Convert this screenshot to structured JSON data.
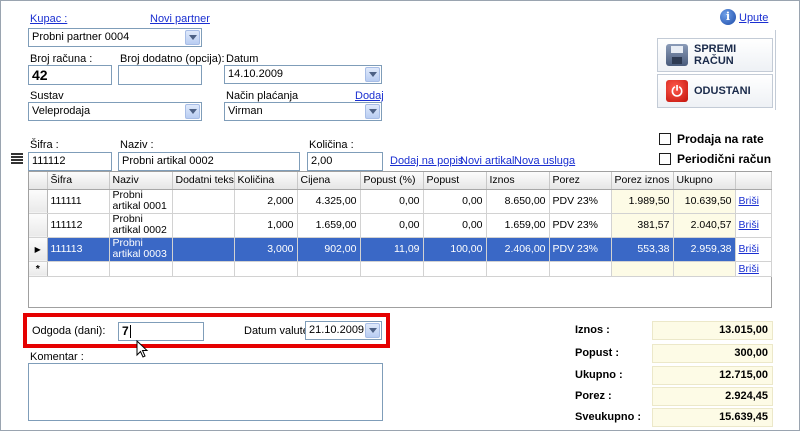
{
  "header": {
    "kupac_label": "Kupac :",
    "novi_partner_link": "Novi partner",
    "kupac_value": "Probni partner 0004",
    "upute_link": "Upute"
  },
  "invoice": {
    "broj_racuna_label": "Broj računa :",
    "broj_racuna_value": "42",
    "broj_dodatno_label": "Broj dodatno (opcija):",
    "broj_dodatno_value": "",
    "datum_label": "Datum",
    "datum_value": "14.10.2009",
    "sustav_label": "Sustav",
    "sustav_value": "Veleprodaja",
    "nacin_placanja_label": "Način plaćanja",
    "dodaj_link": "Dodaj",
    "nacin_placanja_value": "Virman"
  },
  "actions": {
    "spremi_label": "SPREMI RAČUN",
    "odustani_label": "ODUSTANI",
    "prodaja_na_rate_label": "Prodaja na rate",
    "periodicni_racun_label": "Periodični račun"
  },
  "entry": {
    "sifra_label": "Šifra :",
    "sifra_value": "111112",
    "naziv_label": "Naziv :",
    "naziv_value": "Probni artikal 0002",
    "kolicina_label": "Količina :",
    "kolicina_value": "2,00",
    "dodaj_na_popis_link": "Dodaj na popis",
    "novi_artikal_link": "Novi artikal",
    "nova_usluga_link": "Nova usluga"
  },
  "grid": {
    "columns": [
      "Šifra",
      "Naziv",
      "Dodatni tekst",
      "Količina",
      "Cijena",
      "Popust (%)",
      "Popust",
      "Iznos",
      "Porez",
      "Porez iznos",
      "Ukupno",
      ""
    ],
    "rows": [
      {
        "sifra": "111111",
        "naziv": "Probni artikal 0001",
        "dodatni": "",
        "kolicina": "2,000",
        "cijena": "4.325,00",
        "popust_pct": "0,00",
        "popust": "0,00",
        "iznos": "8.650,00",
        "porez": "PDV 23%",
        "porez_iznos": "1.989,50",
        "ukupno": "10.639,50",
        "action": "Briši"
      },
      {
        "sifra": "111112",
        "naziv": "Probni artikal 0002",
        "dodatni": "",
        "kolicina": "1,000",
        "cijena": "1.659,00",
        "popust_pct": "0,00",
        "popust": "0,00",
        "iznos": "1.659,00",
        "porez": "PDV 23%",
        "porez_iznos": "381,57",
        "ukupno": "2.040,57",
        "action": "Briši"
      },
      {
        "sifra": "111113",
        "naziv": "Probni artikal 0003",
        "dodatni": "",
        "kolicina": "3,000",
        "cijena": "902,00",
        "popust_pct": "11,09",
        "popust": "100,00",
        "iznos": "2.406,00",
        "porez": "PDV 23%",
        "porez_iznos": "553,38",
        "ukupno": "2.959,38",
        "action": "Briši"
      }
    ],
    "new_row_marker": "*",
    "new_row_action": "Briši",
    "selected_marker": "▶"
  },
  "payment": {
    "odgoda_label": "Odgoda (dani):",
    "odgoda_value": "7",
    "datum_valute_label": "Datum valute",
    "datum_valute_value": "21.10.2009",
    "komentar_label": "Komentar :"
  },
  "totals": {
    "iznos_label": "Iznos :",
    "iznos_value": "13.015,00",
    "popust_label": "Popust :",
    "popust_value": "300,00",
    "ukupno_label": "Ukupno :",
    "ukupno_value": "12.715,00",
    "porez_label": "Porez :",
    "porez_value": "2.924,45",
    "sveukupno_label": "Sveukupno :",
    "sveukupno_value": "15.639,45"
  },
  "colors": {
    "highlight_box": "#e50000",
    "selected_row": "#3a68c6",
    "link": "#1a2fd1",
    "totals_bg": "#fdfbe6"
  }
}
